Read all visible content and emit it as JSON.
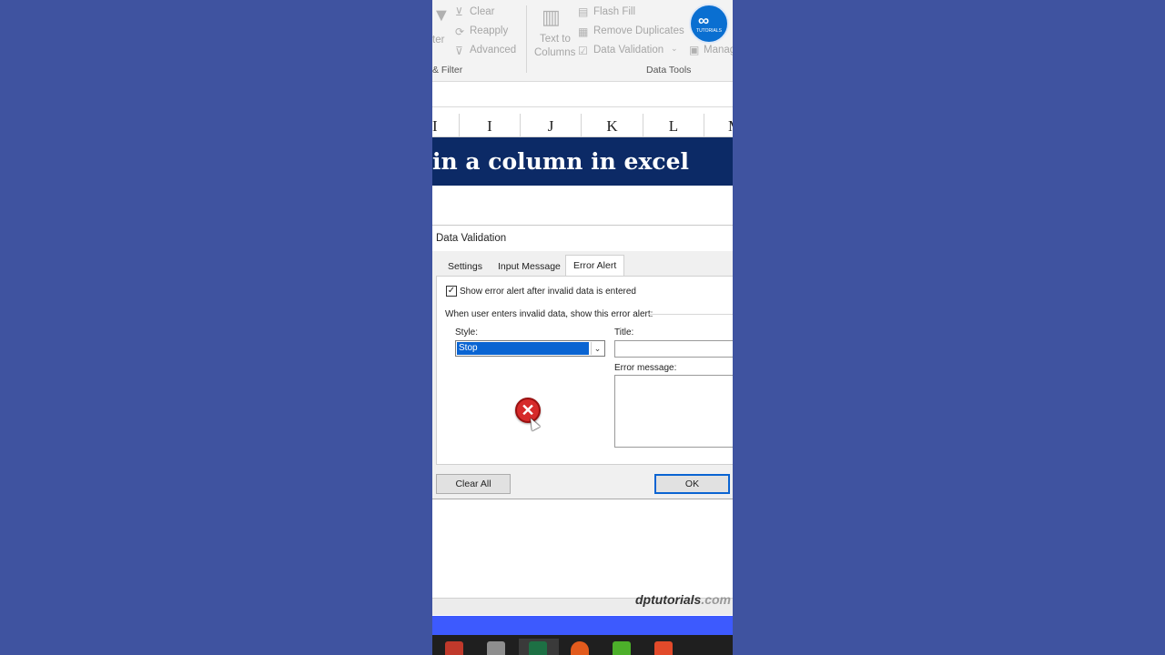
{
  "ribbon": {
    "sort_filter": {
      "filter_partial": "ter",
      "clear": "Clear",
      "reapply": "Reapply",
      "advanced": "Advanced",
      "group_label": "& Filter"
    },
    "data_tools": {
      "text_to_columns_line1": "Text to",
      "text_to_columns_line2": "Columns",
      "flash_fill": "Flash Fill",
      "remove_duplicates": "Remove Duplicates",
      "data_validation": "Data Validation",
      "manage_partial": "Manag",
      "group_label": "Data Tools"
    },
    "logo_text": "TUTORIALS"
  },
  "columns": [
    "I",
    "I",
    "J",
    "K",
    "L",
    "M"
  ],
  "banner_text": "in a column in excel",
  "dialog": {
    "title": "Data Validation",
    "tabs": [
      "Settings",
      "Input Message",
      "Error Alert"
    ],
    "active_tab": "Error Alert",
    "show_alert_label": "Show error alert after invalid data is entered",
    "show_alert_checked": true,
    "instruction": "When user enters invalid data, show this error alert:",
    "style_label": "Style:",
    "style_value": "Stop",
    "title_label": "Title:",
    "title_value": "",
    "error_message_label": "Error message:",
    "error_message_value": "",
    "clear_all_label": "Clear All",
    "ok_label": "OK"
  },
  "watermark": {
    "main": "dptutorials",
    "suffix": ".com"
  },
  "colors": {
    "background": "#3f53a0",
    "banner": "#0c2a66",
    "selection": "#0a64d2",
    "status_bar": "#3d5afe"
  }
}
